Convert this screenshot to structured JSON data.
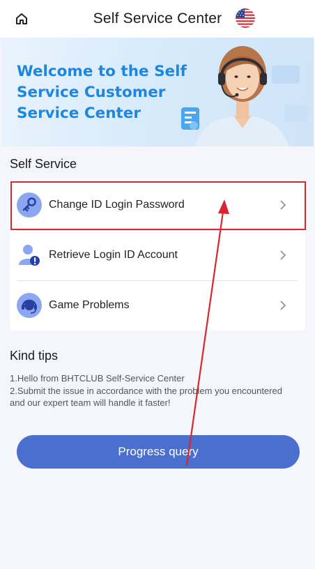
{
  "header": {
    "title": "Self Service Center",
    "home_icon": "home-icon",
    "language_flag": "us-flag-icon"
  },
  "banner": {
    "title": "Welcome to the Self Service Customer Service Center"
  },
  "self_service": {
    "title": "Self Service",
    "items": [
      {
        "label": "Change ID Login Password",
        "icon": "key-icon",
        "highlighted": true
      },
      {
        "label": "Retrieve Login ID Account",
        "icon": "user-alert-icon"
      },
      {
        "label": "Game Problems",
        "icon": "headset-icon"
      }
    ]
  },
  "tips": {
    "title": "Kind tips",
    "lines": [
      "1.Hello from BHTCLUB Self-Service Center",
      "2.Submit the issue in accordance with the problem you encountered and our expert team will handle it faster!"
    ]
  },
  "actions": {
    "progress_query": "Progress query"
  },
  "colors": {
    "accent": "#4a6fcf",
    "banner_text": "#1f86e0",
    "annotation": "#d8262e",
    "background": "#f4f6fc"
  }
}
